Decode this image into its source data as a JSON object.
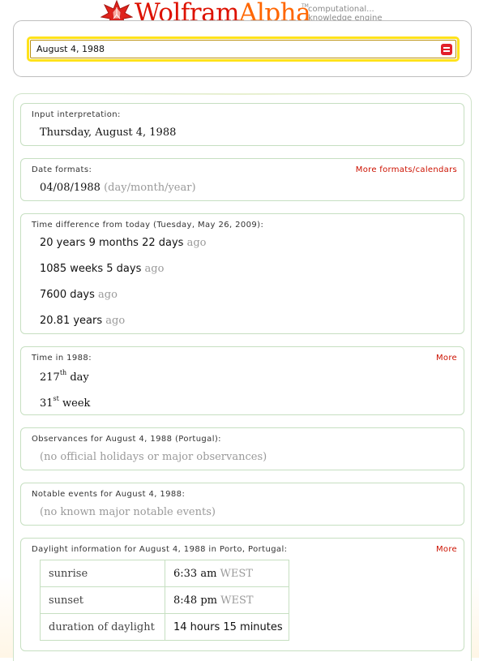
{
  "logo": {
    "word_1": "Wolfram",
    "word_2": "Alpha",
    "trademark": "TM",
    "tagline_1": "computational...",
    "tagline_2": "knowledge engine"
  },
  "search": {
    "value": "August 4, 1988",
    "clear_icon": "clear-icon"
  },
  "pods": {
    "input_interpretation": {
      "title": "Input interpretation:",
      "value": "Thursday, August 4, 1988"
    },
    "date_formats": {
      "title": "Date formats:",
      "more": "More formats/calendars",
      "value": "04/08/1988",
      "note": "(day/month/year)"
    },
    "time_difference": {
      "title": "Time difference from today (Tuesday, May 26, 2009):",
      "rows": [
        {
          "value": "20 years  9 months  22 days",
          "suffix": "ago"
        },
        {
          "value": "1085 weeks  5 days",
          "suffix": "ago"
        },
        {
          "value": "7600 days",
          "suffix": "ago"
        },
        {
          "value": "20.81 years",
          "suffix": "ago"
        }
      ]
    },
    "time_in_1988": {
      "title": "Time in 1988:",
      "more": "More",
      "day_number": "217",
      "day_ordinal": "th",
      "day_unit": "day",
      "week_number": "31",
      "week_ordinal": "st",
      "week_unit": "week"
    },
    "observances": {
      "title": "Observances for August 4, 1988 (Portugal):",
      "value": "(no official holidays or major observances)"
    },
    "notable_events": {
      "title": "Notable events for August 4, 1988:",
      "value": "(no known major notable events)"
    },
    "daylight": {
      "title": "Daylight information for August 4, 1988 in Porto, Portugal:",
      "more": "More",
      "rows": [
        {
          "label": "sunrise",
          "value": "6:33 am",
          "unit": "WEST"
        },
        {
          "label": "sunset",
          "value": "8:48 pm",
          "unit": "WEST"
        },
        {
          "label": "duration of daylight",
          "value": "14 hours  15 minutes",
          "unit": ""
        }
      ]
    }
  },
  "colors": {
    "brand_red": "#dd1100",
    "brand_orange": "#ff6600",
    "link_red": "#cc1100",
    "pod_border": "#c6dfc1",
    "input_highlight": "#ffe21a"
  }
}
